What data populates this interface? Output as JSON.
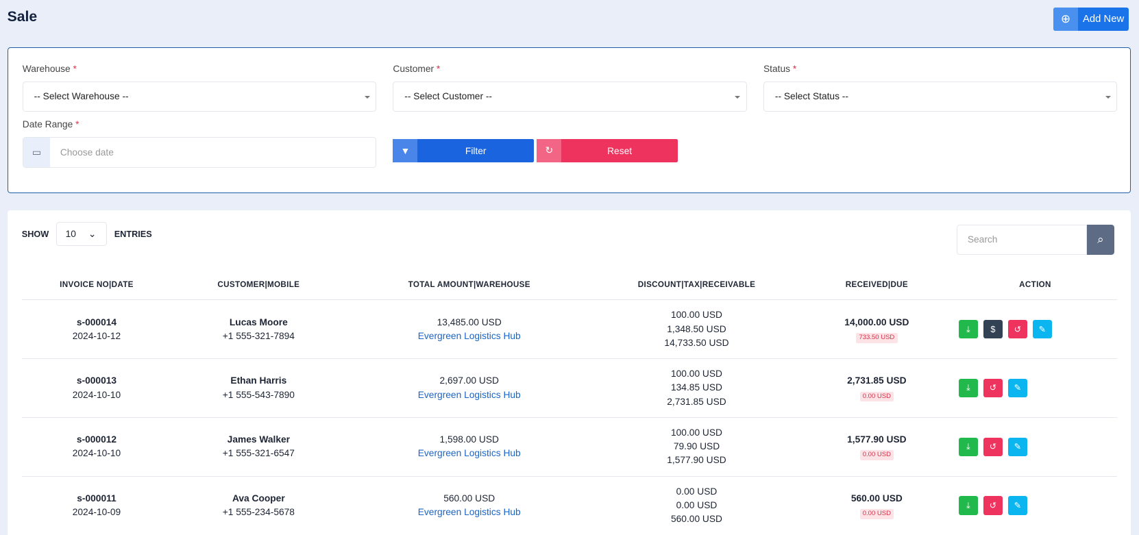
{
  "header": {
    "title": "Sale",
    "add_new": "Add New"
  },
  "filters": {
    "warehouse_label": "Warehouse",
    "warehouse_value": "-- Select Warehouse --",
    "customer_label": "Customer",
    "customer_value": "-- Select Customer --",
    "status_label": "Status",
    "status_value": "-- Select Status --",
    "date_label": "Date Range",
    "date_placeholder": "Choose date",
    "required": "*",
    "filter": "Filter",
    "reset": "Reset"
  },
  "table": {
    "show": "SHOW",
    "entries_value": "10",
    "entries": "ENTRIES",
    "search_placeholder": "Search",
    "headers": [
      "INVOICE NO|DATE",
      "CUSTOMER|MOBILE",
      "TOTAL AMOUNT|WAREHOUSE",
      "DISCOUNT|TAX|RECEIVABLE",
      "RECEIVED|DUE",
      "ACTION"
    ],
    "rows": [
      {
        "invoice": "s-000014",
        "date": "2024-10-12",
        "customer": "Lucas Moore",
        "mobile": "+1 555-321-7894",
        "total": "13,485.00 USD",
        "warehouse": "Evergreen Logistics Hub",
        "discount": "100.00 USD",
        "tax": "1,348.50 USD",
        "receivable": "14,733.50 USD",
        "received": "14,000.00 USD",
        "due": "733.50 USD"
      },
      {
        "invoice": "s-000013",
        "date": "2024-10-10",
        "customer": "Ethan Harris",
        "mobile": "+1 555-543-7890",
        "total": "2,697.00 USD",
        "warehouse": "Evergreen Logistics Hub",
        "discount": "100.00 USD",
        "tax": "134.85 USD",
        "receivable": "2,731.85 USD",
        "received": "2,731.85 USD",
        "due": "0.00 USD"
      },
      {
        "invoice": "s-000012",
        "date": "2024-10-10",
        "customer": "James Walker",
        "mobile": "+1 555-321-6547",
        "total": "1,598.00 USD",
        "warehouse": "Evergreen Logistics Hub",
        "discount": "100.00 USD",
        "tax": "79.90 USD",
        "receivable": "1,577.90 USD",
        "received": "1,577.90 USD",
        "due": "0.00 USD"
      },
      {
        "invoice": "s-000011",
        "date": "2024-10-09",
        "customer": "Ava Cooper",
        "mobile": "+1 555-234-5678",
        "total": "560.00 USD",
        "warehouse": "Evergreen Logistics Hub",
        "discount": "0.00 USD",
        "tax": "0.00 USD",
        "receivable": "560.00 USD",
        "received": "560.00 USD",
        "due": "0.00 USD"
      }
    ]
  }
}
